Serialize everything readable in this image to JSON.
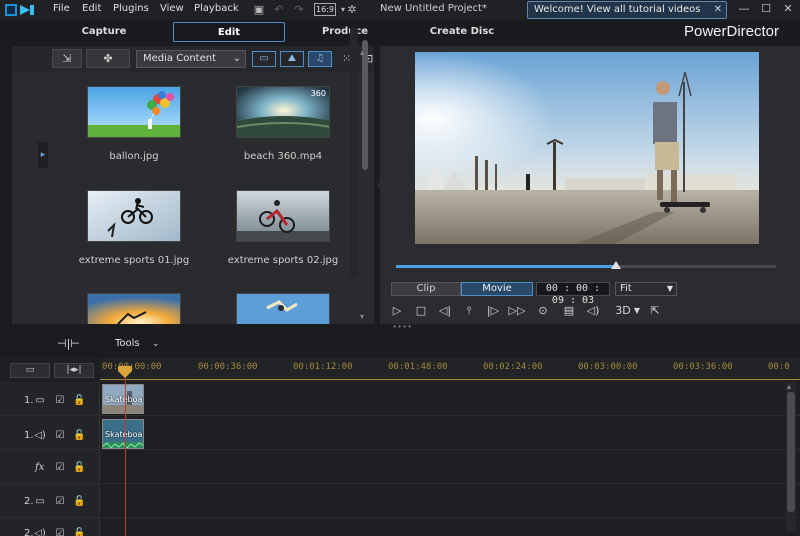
{
  "menubar": {
    "items": [
      "File",
      "Edit",
      "Plugins",
      "View",
      "Playback"
    ],
    "aspect": "16:9",
    "project_title": "New Untitled Project*",
    "welcome_text": "Welcome! View all tutorial videos here!"
  },
  "modes": {
    "tabs": [
      "Capture",
      "Edit",
      "Produce",
      "Create Disc"
    ],
    "active": "Edit"
  },
  "brand": "PowerDirector",
  "library": {
    "dropdown_value": "Media Content",
    "items": [
      {
        "label": "ballon.jpg",
        "badge": ""
      },
      {
        "label": "beach 360.mp4",
        "badge": "360"
      },
      {
        "label": "extreme sports 01.jpg",
        "badge": ""
      },
      {
        "label": "extreme sports 02.jpg",
        "badge": ""
      },
      {
        "label": "",
        "badge": ""
      },
      {
        "label": "",
        "badge": ""
      }
    ]
  },
  "preview": {
    "mode_clip": "Clip",
    "mode_movie": "Movie",
    "timecode": "00 : 00 : 09 : 03",
    "fit": "Fit",
    "three_d": "3D",
    "progress": 0.58
  },
  "tools": {
    "label": "Tools"
  },
  "timeline": {
    "ticks": [
      "00:00:00:00",
      "00:00:36:00",
      "00:01:12:00",
      "00:01:48:00",
      "00:02:24:00",
      "00:03:00:00",
      "00:03:36:00",
      "00:0"
    ],
    "tracks": [
      {
        "label": "1."
      },
      {
        "label": "1."
      },
      {
        "label": "fx"
      },
      {
        "label": "2."
      },
      {
        "label": "2."
      }
    ],
    "clips": [
      "Skateboard",
      "Skateboard"
    ]
  },
  "colors": {
    "accent": "#4c8fc9",
    "playhead": "#c0392b",
    "scrub": "#4c9fe0"
  }
}
